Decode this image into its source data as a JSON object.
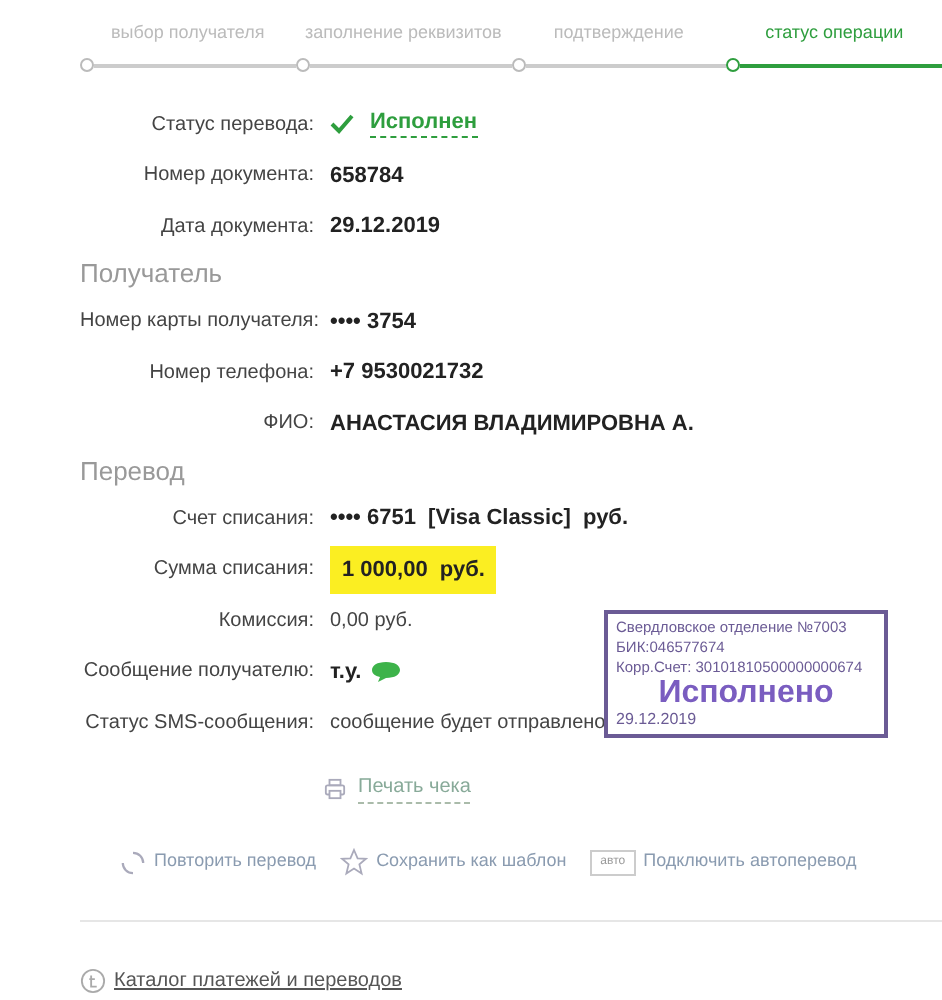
{
  "steps": [
    {
      "label": "выбор получателя",
      "selected": false
    },
    {
      "label": "заполнение реквизитов",
      "selected": false
    },
    {
      "label": "подтверждение",
      "selected": false
    },
    {
      "label": "статус операции",
      "selected": true
    }
  ],
  "sections": [
    {
      "rows": [
        {
          "label": "Статус перевода:",
          "value": "Исполнен",
          "kind": "status"
        },
        {
          "label": "Номер документа:",
          "value": "658784",
          "kind": "bold"
        },
        {
          "label": "Дата документа:",
          "value": "29.12.2019",
          "kind": "bold"
        }
      ]
    },
    {
      "heading": "Получатель",
      "rows": [
        {
          "label": "Номер карты получателя:",
          "value": "•••• 3754",
          "kind": "bold"
        },
        {
          "label": "Номер телефона:",
          "value": "+7 9530021732",
          "kind": "bold"
        },
        {
          "label": "ФИО:",
          "value": "АНАСТАСИЯ ВЛАДИМИРОВНА А.",
          "kind": "bold"
        }
      ]
    },
    {
      "heading": "Перевод",
      "rows": [
        {
          "label": "Счет списания:",
          "value": "•••• 6751  [Visa Classic]  руб.",
          "kind": "bold"
        },
        {
          "label": "Сумма списания:",
          "value": "1 000,00  руб.",
          "kind": "highlight"
        },
        {
          "label": "Комиссия:",
          "value": "0,00 руб.",
          "kind": "text"
        },
        {
          "label": "Сообщение получателю:",
          "value": "т.у.",
          "kind": "message"
        },
        {
          "label": "Статус SMS-сообщения:",
          "value": "сообщение будет отправлено",
          "kind": "text"
        }
      ]
    }
  ],
  "stamp": {
    "lines": [
      "Свердловское отделение №7003",
      "БИК:046577674",
      "Корр.Счет: 30101810500000000674"
    ],
    "status": "Исполнено",
    "date": "29.12.2019"
  },
  "print_link": "Печать чека",
  "actions": [
    {
      "label": "Повторить перевод",
      "kind": "repeat"
    },
    {
      "label": "Сохранить как шаблон",
      "kind": "template"
    },
    {
      "label": "Подключить автоперевод",
      "kind": "auto",
      "badge": "авто"
    }
  ],
  "catalog_link": "Каталог платежей и переводов"
}
